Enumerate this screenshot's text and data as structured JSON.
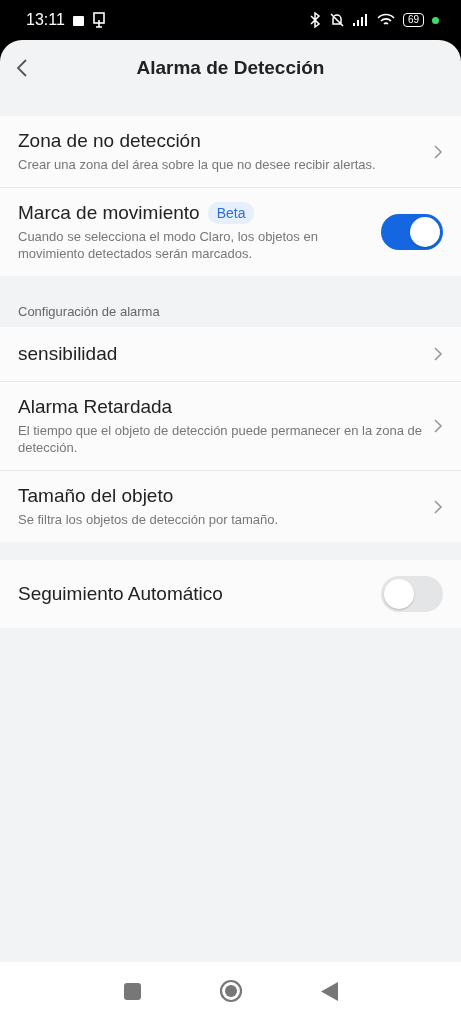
{
  "status_bar": {
    "time": "13:11",
    "battery": "69"
  },
  "header": {
    "title": "Alarma de Detección"
  },
  "groups": [
    {
      "items": [
        {
          "kind": "link",
          "title": "Zona de no detección",
          "subtitle": "Crear una zona del área sobre la que no desee recibir alertas."
        },
        {
          "kind": "toggle",
          "title": "Marca de movimiento",
          "badge": "Beta",
          "subtitle": "Cuando se selecciona el modo Claro, los objetos en movimiento detectados serán marcados.",
          "on": true
        }
      ]
    },
    {
      "section": "Configuración de alarma",
      "items": [
        {
          "kind": "link",
          "title": "sensibilidad"
        },
        {
          "kind": "link",
          "title": "Alarma Retardada",
          "subtitle": "El tiempo que el objeto de detección puede permanecer en la zona de detección."
        },
        {
          "kind": "link",
          "title": "Tamaño del objeto",
          "subtitle": "Se filtra los objetos de detección por tamaño."
        }
      ]
    },
    {
      "items": [
        {
          "kind": "toggle",
          "title": "Seguimiento Automático",
          "on": false
        }
      ]
    }
  ]
}
